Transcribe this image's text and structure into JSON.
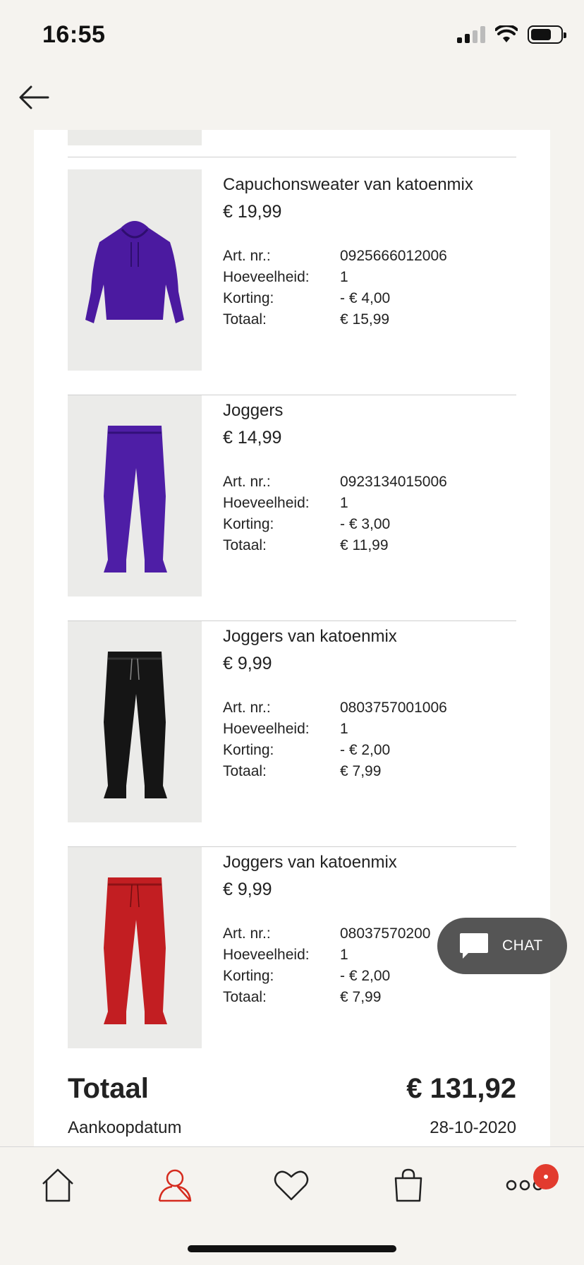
{
  "status_bar": {
    "time": "16:55"
  },
  "order_items": [
    {
      "name": "Capuchonsweater van katoenmix",
      "price": "€ 19,99",
      "color": "#4b1aa0",
      "image_icon": "hoodie-icon",
      "details": [
        {
          "label": "Art. nr.:",
          "value": "0925666012006"
        },
        {
          "label": "Hoeveelheid:",
          "value": "1"
        },
        {
          "label": "Korting:",
          "value": "- € 4,00"
        },
        {
          "label": "Totaal:",
          "value": "€ 15,99"
        }
      ]
    },
    {
      "name": "Joggers",
      "price": "€ 14,99",
      "color": "#4e1ea6",
      "image_icon": "joggers-icon",
      "details": [
        {
          "label": "Art. nr.:",
          "value": "0923134015006"
        },
        {
          "label": "Hoeveelheid:",
          "value": "1"
        },
        {
          "label": "Korting:",
          "value": "- € 3,00"
        },
        {
          "label": "Totaal:",
          "value": "€ 11,99"
        }
      ]
    },
    {
      "name": "Joggers van katoenmix",
      "price": "€ 9,99",
      "color": "#151515",
      "image_icon": "joggers-icon",
      "details": [
        {
          "label": "Art. nr.:",
          "value": "0803757001006"
        },
        {
          "label": "Hoeveelheid:",
          "value": "1"
        },
        {
          "label": "Korting:",
          "value": "- € 2,00"
        },
        {
          "label": "Totaal:",
          "value": "€ 7,99"
        }
      ]
    },
    {
      "name": "Joggers van katoenmix",
      "price": "€ 9,99",
      "color": "#c21e22",
      "image_icon": "joggers-icon",
      "details": [
        {
          "label": "Art. nr.:",
          "value": "08037570200"
        },
        {
          "label": "Hoeveelheid:",
          "value": "1"
        },
        {
          "label": "Korting:",
          "value": "- € 2,00"
        },
        {
          "label": "Totaal:",
          "value": "€ 7,99"
        }
      ]
    }
  ],
  "summary": {
    "total_label": "Totaal",
    "total_value": "€ 131,92",
    "date_label": "Aankoopdatum",
    "date_value": "28-10-2020"
  },
  "chat": {
    "label": "CHAT"
  },
  "tab_bar": {
    "items": [
      {
        "icon": "home-icon",
        "active": false
      },
      {
        "icon": "account-icon",
        "active": true
      },
      {
        "icon": "heart-icon",
        "active": false
      },
      {
        "icon": "bag-icon",
        "active": false
      },
      {
        "icon": "more-icon",
        "active": false
      }
    ],
    "active_color": "#d52b1e"
  }
}
